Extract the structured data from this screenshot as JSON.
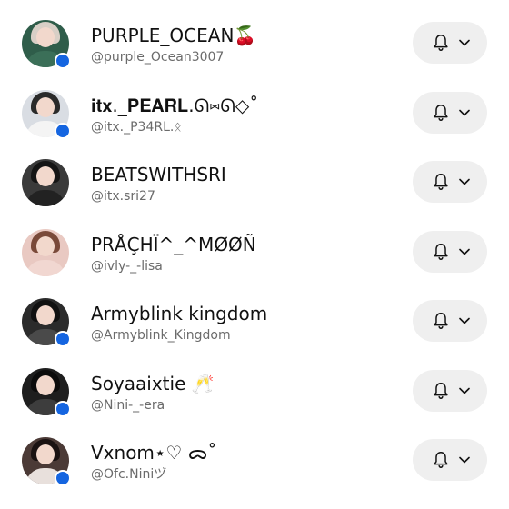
{
  "accounts": [
    {
      "name": "PURPLE_OCEAN🍒",
      "handle": "@purple_Ocean3007",
      "online": true,
      "avatar_colors": {
        "bg": "#2f5d4a",
        "hair": "#d8cfc6",
        "shoulders": "#3b6f58"
      },
      "notify_icon": "bell-icon",
      "menu_icon": "chevron-down-icon"
    },
    {
      "name": "𝐢𝐭𝐱._𝐏𝐄𝐀𝐑𝐋.ᘏ⑅ᘏ◇˚",
      "handle": "@itx._P34RL.ᛟ",
      "online": true,
      "avatar_colors": {
        "bg": "#d9dde3",
        "hair": "#2a2a2a",
        "shoulders": "#f4f4f4"
      },
      "notify_icon": "bell-icon",
      "menu_icon": "chevron-down-icon"
    },
    {
      "name": "BEATSWITHSRI",
      "handle": "@itx.sri27",
      "online": false,
      "avatar_colors": {
        "bg": "#3a3a3a",
        "hair": "#151515",
        "shoulders": "#222222"
      },
      "notify_icon": "bell-icon",
      "menu_icon": "chevron-down-icon"
    },
    {
      "name": "PRÅÇHÏ^_^MØØÑ",
      "handle": "@ivly-_-lisa",
      "online": false,
      "avatar_colors": {
        "bg": "#e9c9c2",
        "hair": "#7a4a3a",
        "shoulders": "#f1d7d1"
      },
      "notify_icon": "bell-icon",
      "menu_icon": "chevron-down-icon"
    },
    {
      "name": "Armyblink kingdom",
      "handle": "@Armyblink_Kingdom",
      "online": true,
      "avatar_colors": {
        "bg": "#2b2b2b",
        "hair": "#111111",
        "shoulders": "#4a4a4a"
      },
      "notify_icon": "bell-icon",
      "menu_icon": "chevron-down-icon"
    },
    {
      "name": "Soyaaixtie 🥂",
      "handle": "@Nini-_-era",
      "online": true,
      "avatar_colors": {
        "bg": "#1e1e1e",
        "hair": "#0c0c0c",
        "shoulders": "#3d3d3d"
      },
      "notify_icon": "bell-icon",
      "menu_icon": "chevron-down-icon"
    },
    {
      "name": "Vxnom⋆♡ ᯅ˚",
      "handle": "@Ofc.Niniヅ",
      "online": true,
      "avatar_colors": {
        "bg": "#4b3a36",
        "hair": "#1a1212",
        "shoulders": "#e8e0dc"
      },
      "notify_icon": "bell-icon",
      "menu_icon": "chevron-down-icon"
    }
  ],
  "colors": {
    "accent": "#1565e0",
    "button_bg": "#efefef",
    "name_text": "#111111",
    "handle_text": "#6b6b6b"
  }
}
